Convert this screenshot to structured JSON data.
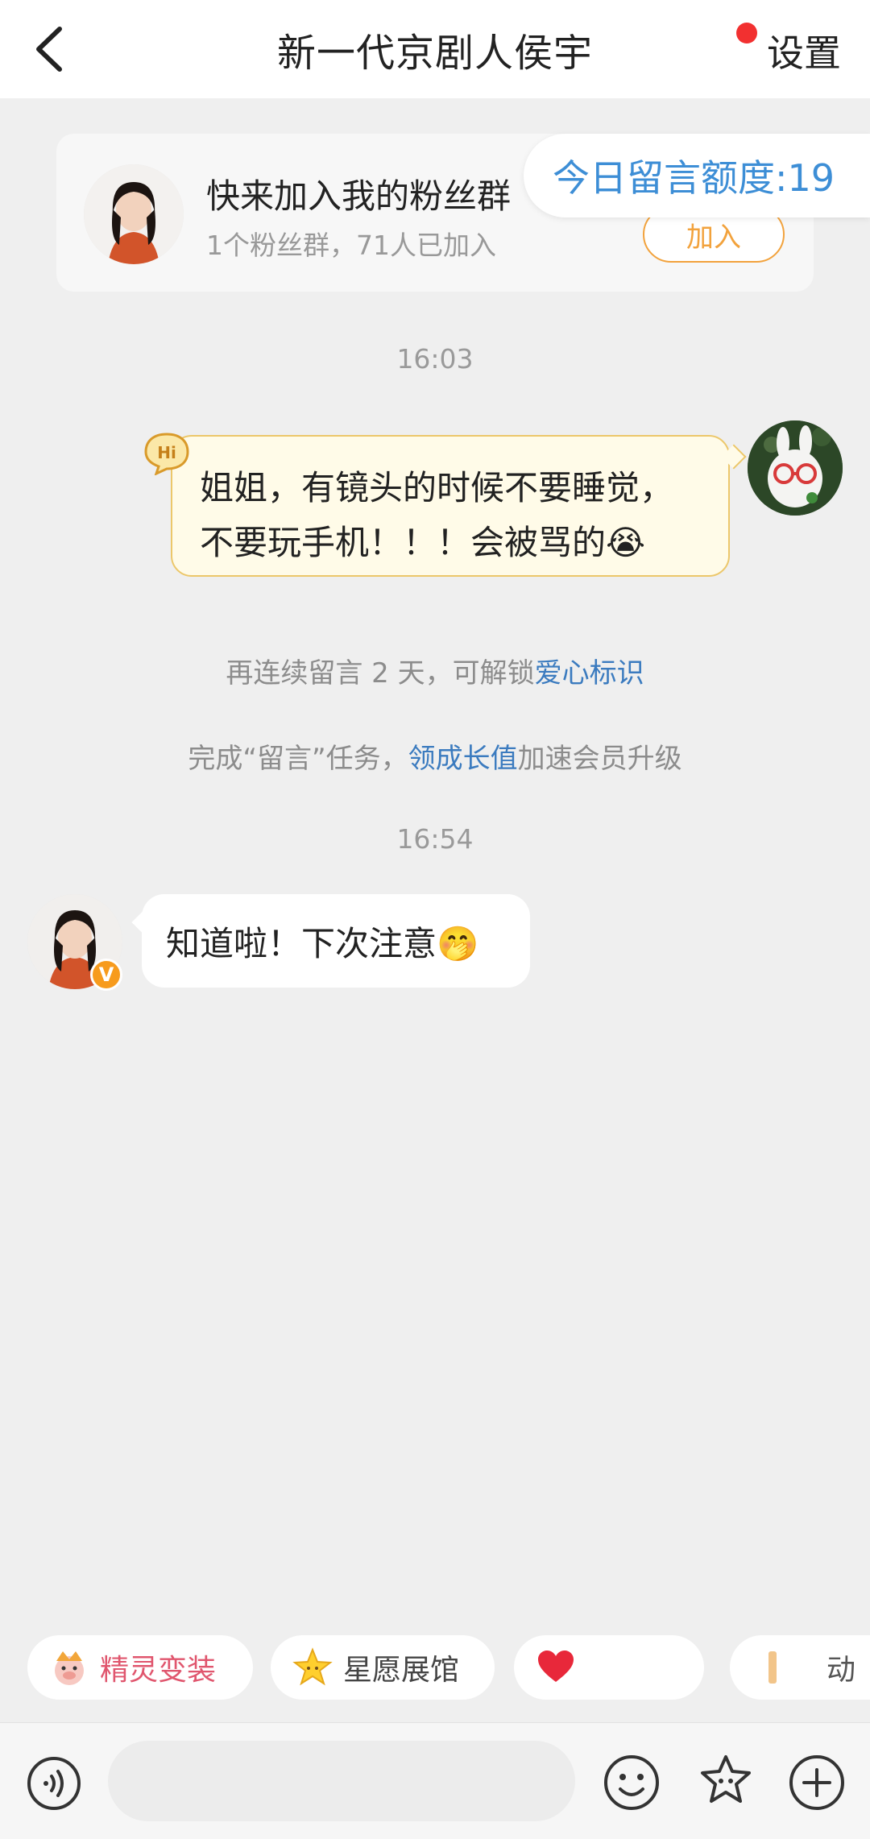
{
  "header": {
    "title": "新一代京剧人侯宇",
    "settings_label": "设置"
  },
  "fan_group": {
    "title": "快来加入我的粉丝群",
    "subtitle": "1个粉丝群，71人已加入",
    "join_label": "加入"
  },
  "quota": {
    "label": "今日留言额度:19"
  },
  "messages": [
    {
      "timestamp": "16:03",
      "direction": "outgoing",
      "lines": [
        "姐姐，有镜头的时候不要睡觉，",
        "不要玩手机！！！会被骂的😭"
      ]
    },
    {
      "timestamp": "16:54",
      "direction": "incoming",
      "text": "知道啦！下次注意🤭"
    }
  ],
  "hints": {
    "streak_prefix": "再连续留言 2 天，可解锁",
    "streak_link": "爱心标识",
    "task_prefix": "完成“留言”任务，",
    "task_link": "领成长值",
    "task_suffix": "加速会员升级"
  },
  "chips": [
    {
      "label": "精灵变装",
      "icon": "pig-mascot-icon"
    },
    {
      "label": "星愿展馆",
      "icon": "star-icon"
    },
    {
      "label": "",
      "icon": "heart-icon"
    },
    {
      "label": "动",
      "icon": "flag-icon"
    }
  ],
  "input_bar": {
    "placeholder": "",
    "icons": [
      "voice-icon",
      "emoji-icon",
      "star-face-icon",
      "plus-icon"
    ]
  },
  "colors": {
    "accent_orange": "#f2a23c",
    "link_blue": "#3b7bbf",
    "quota_blue": "#3d8ed6",
    "notification_red": "#f23030",
    "bubble_yellow": "#fffbe8"
  }
}
